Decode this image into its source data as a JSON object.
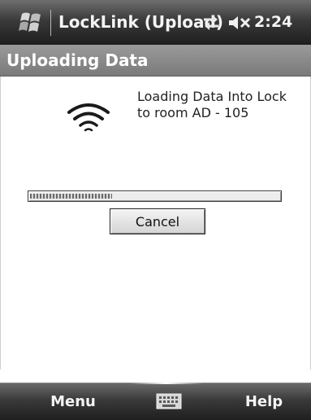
{
  "title_bar": {
    "app_title": "LockLink (Upload)",
    "clock": "2:24",
    "icons": {
      "start": "windows-flag-icon",
      "connectivity": "connectivity-arrows-icon",
      "volume": "speaker-muted-icon"
    }
  },
  "header": {
    "title": "Uploading Data"
  },
  "main": {
    "status_line_1": "Loading Data Into Lock",
    "status_line_2": "to room AD - 105",
    "status_icon": "wireless-signal-icon",
    "progress": 0.33,
    "cancel_label": "Cancel"
  },
  "softkeys": {
    "left_label": "Menu",
    "center_icon": "keyboard-icon",
    "right_label": "Help"
  }
}
